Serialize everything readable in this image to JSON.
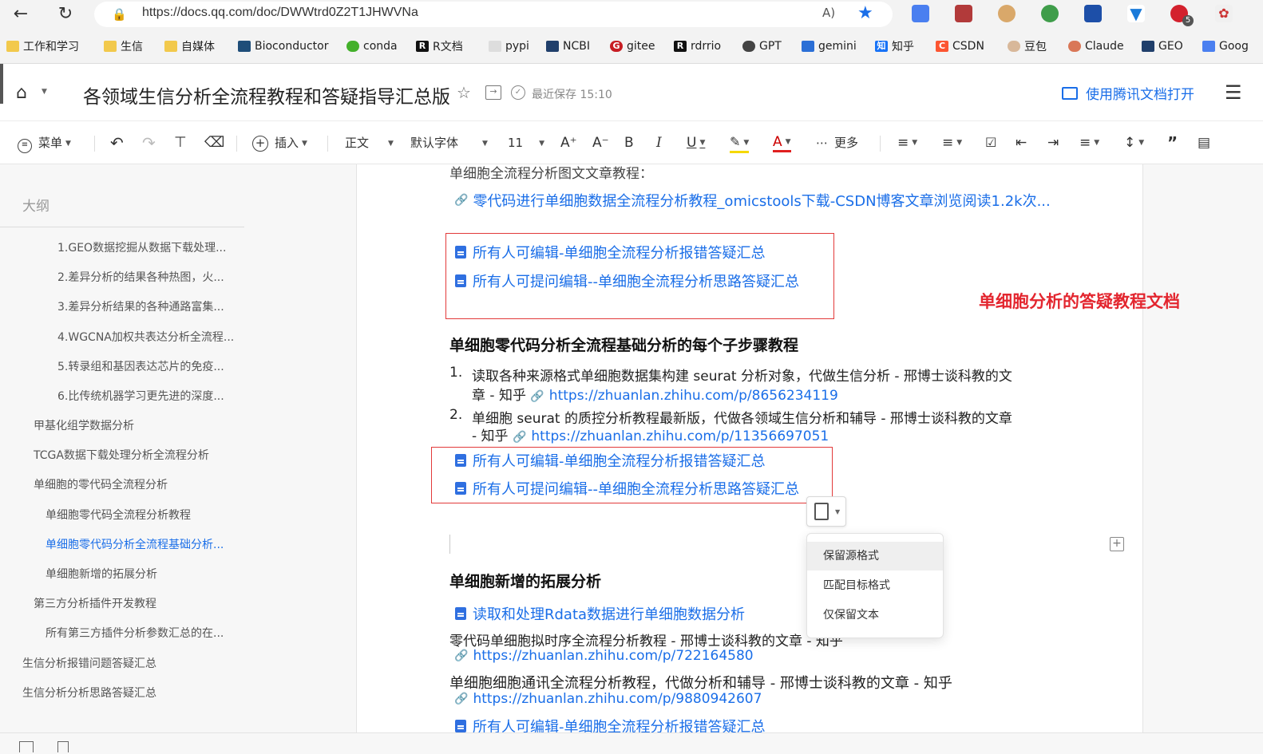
{
  "browser": {
    "url": "https://docs.qq.com/doc/DWWtrd0Z2T1JHWVNa",
    "ext_badge": "5",
    "bookmarks": [
      "工作和学习",
      "生信",
      "自媒体",
      "Bioconductor",
      "conda",
      "R文档",
      "pypi",
      "NCBI",
      "gitee",
      "rdrrio",
      "GPT",
      "gemini",
      "知乎",
      "CSDN",
      "豆包",
      "Claude",
      "GEO",
      "Goog"
    ]
  },
  "header": {
    "title": "各领域生信分析全流程教程和答疑指导汇总版",
    "save_status": "最近保存 15:10",
    "open_app": "使用腾讯文档打开"
  },
  "toolbar": {
    "menu": "菜单",
    "insert": "插入",
    "style": "正文",
    "font": "默认字体",
    "size": "11",
    "more": "更多"
  },
  "sidebar": {
    "title": "大纲",
    "items": [
      {
        "label": "1.GEO数据挖掘从数据下载处理..."
      },
      {
        "label": "2.差异分析的结果各种热图，火..."
      },
      {
        "label": "3.差异分析结果的各种通路富集..."
      },
      {
        "label": "4.WGCNA加权共表达分析全流程..."
      },
      {
        "label": "5.转录组和基因表达芯片的免疫..."
      },
      {
        "label": "6.比传统机器学习更先进的深度..."
      },
      {
        "label": "甲基化组学数据分析"
      },
      {
        "label": "TCGA数据下载处理分析全流程分析"
      },
      {
        "label": "单细胞的零代码全流程分析"
      },
      {
        "label": "单细胞零代码全流程分析教程"
      },
      {
        "label": "单细胞零代码分析全流程基础分析..."
      },
      {
        "label": "单细胞新增的拓展分析"
      },
      {
        "label": "第三方分析插件开发教程"
      },
      {
        "label": "所有第三方插件分析参数汇总的在..."
      },
      {
        "label": "生信分析报错问题答疑汇总"
      },
      {
        "label": "生信分析分析思路答疑汇总"
      }
    ]
  },
  "doc": {
    "top_text": "单细胞全流程分析图文文章教程：",
    "link1": "零代码进行单细胞数据全流程分析教程_omicstools下载-CSDN博客文章浏览阅读1.2k次...",
    "box1_a": "所有人可编辑-单细胞全流程分析报错答疑汇总",
    "box1_b": "所有人可提问编辑--单细胞全流程分析思路答疑汇总",
    "annotation": "单细胞分析的答疑教程文档",
    "heading1": "单细胞零代码分析全流程基础分析的每个子步骤教程",
    "item1_num": "1.",
    "item1_line1": "读取各种来源格式单细胞数据集构建 seurat 分析对象，代做生信分析 - 邢博士谈科教的文",
    "item1_line2": "章 - 知乎",
    "item1_url": "https://zhuanlan.zhihu.com/p/8656234119",
    "item2_num": "2.",
    "item2_line1": "单细胞 seurat 的质控分析教程最新版，代做各领域生信分析和辅导 - 邢博士谈科教的文章",
    "item2_line2": "- 知乎",
    "item2_url": "https://zhuanlan.zhihu.com/p/11356697051",
    "box2_a": "所有人可编辑-单细胞全流程分析报错答疑汇总",
    "box2_b": "所有人可提问编辑--单细胞全流程分析思路答疑汇总",
    "heading2": "单细胞新增的拓展分析",
    "rdata_link": "读取和处理Rdata数据进行单细胞数据分析",
    "pseudo_text": "零代码单细胞拟时序全流程分析教程 - 邢博士谈科教的文章 - 知乎",
    "pseudo_url": "https://zhuanlan.zhihu.com/p/722164580",
    "comm_text": "单细胞细胞通讯全流程分析教程，代做分析和辅导 - 邢博士谈科教的文章 - 知乎",
    "comm_url": "https://zhuanlan.zhihu.com/p/9880942607",
    "bottom_link": "所有人可编辑-单细胞全流程分析报错答疑汇总"
  },
  "paste_menu": {
    "items": [
      "保留源格式",
      "匹配目标格式",
      "仅保留文本"
    ]
  }
}
